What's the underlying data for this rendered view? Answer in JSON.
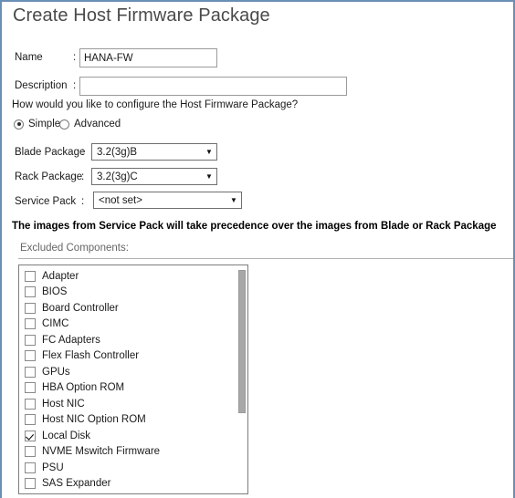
{
  "dialog": {
    "title": "Create Host Firmware Package",
    "accent_color": "#6a8fb5"
  },
  "form": {
    "name_label": "Name",
    "name_colon": ":",
    "name_value": "HANA-FW",
    "description_label": "Description",
    "description_colon": ":",
    "description_value": "",
    "question": "How would you like to configure the Host Firmware Package?"
  },
  "mode": {
    "simple_label": "Simple",
    "advanced_label": "Advanced",
    "selected": "Simple"
  },
  "packages": {
    "blade_label": "Blade Package",
    "blade_colon": ":",
    "blade_value": "3.2(3g)B",
    "rack_label": "Rack Package",
    "rack_colon": ":",
    "rack_value": "3.2(3g)C",
    "service_label": "Service Pack",
    "service_colon": ":",
    "service_value": "<not set>",
    "arrow_glyph": "▼"
  },
  "notice": "The images from Service Pack will take precedence over the images from Blade or Rack Package",
  "excluded": {
    "section_label": "Excluded Components:",
    "items": [
      {
        "label": "Adapter",
        "checked": false
      },
      {
        "label": "BIOS",
        "checked": false
      },
      {
        "label": "Board Controller",
        "checked": false
      },
      {
        "label": "CIMC",
        "checked": false
      },
      {
        "label": "FC Adapters",
        "checked": false
      },
      {
        "label": "Flex Flash Controller",
        "checked": false
      },
      {
        "label": "GPUs",
        "checked": false
      },
      {
        "label": "HBA Option ROM",
        "checked": false
      },
      {
        "label": "Host NIC",
        "checked": false
      },
      {
        "label": "Host NIC Option ROM",
        "checked": false
      },
      {
        "label": "Local Disk",
        "checked": true
      },
      {
        "label": "NVME Mswitch Firmware",
        "checked": false
      },
      {
        "label": "PSU",
        "checked": false
      },
      {
        "label": "SAS Expander",
        "checked": false
      }
    ]
  }
}
